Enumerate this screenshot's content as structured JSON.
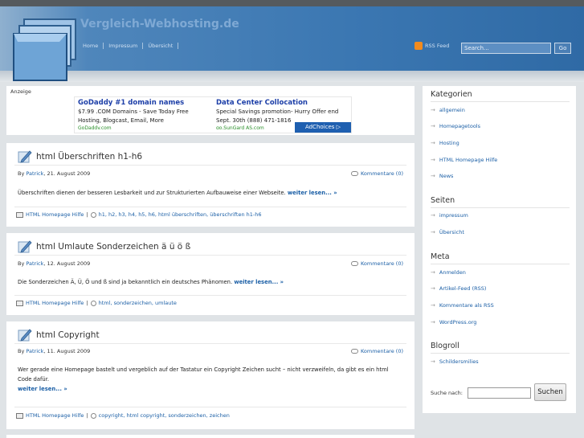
{
  "site": {
    "title": "Vergleich-Webhosting.de",
    "nav": [
      "Home",
      "Impressum",
      "Übersicht"
    ],
    "rss_label": "RSS Feed",
    "search_placeholder": "Search...",
    "go_label": "Go"
  },
  "ad": {
    "label": "Anzeige",
    "left": {
      "title": "GoDaddy #1 domain names",
      "line1": "$7.99 .COM Domains - Save Today Free",
      "line2": "Hosting, Blogcast, Email, More",
      "url": "GoDaddy.com"
    },
    "right": {
      "title": "Data Center Collocation",
      "line1": "Special Savings promotion- Hurry Offer end",
      "line2": "Sept. 30th (888) 471-1816",
      "url": "go.SunGard AS.com"
    },
    "adchoices": "AdChoices ▷"
  },
  "posts": [
    {
      "title": "html Überschriften h1-h6",
      "by": "By",
      "author": "Patrick",
      "date": ", 21. August 2009",
      "comments": "Kommentare (0)",
      "excerpt": "Überschriften dienen der besseren Lesbarkeit und zur Strukturierten Aufbauweise einer Webseite.",
      "more": "weiter lesen... »",
      "category": "HTML Homepage Hilfe",
      "tags": "h1, h2, h3, h4, h5, h6, html überschriften, überschriften h1-h6"
    },
    {
      "title": "html Umlaute Sonderzeichen ä ü ö ß",
      "by": "By",
      "author": "Patrick",
      "date": ", 12. August 2009",
      "comments": "Kommentare (0)",
      "excerpt": "Die Sonderzeichen Ä, Ü, Ö und ß sind ja bekanntlich ein deutsches Phänomen.",
      "more": "weiter lesen... »",
      "category": "HTML Homepage Hilfe",
      "tags": "html, sonderzeichen, umlaute"
    },
    {
      "title": "html Copyright",
      "by": "By",
      "author": "Patrick",
      "date": ", 11. August 2009",
      "comments": "Kommentare (0)",
      "excerpt": "Wer gerade eine Homepage bastelt und vergeblich auf der Tastatur ein Copyright Zeichen sucht – nicht verzweifeln, da gibt es ein html Code dafür.",
      "more": "weiter lesen... »",
      "category": "HTML Homepage Hilfe",
      "tags": "copyright, html copyright, sonderzeichen, zeichen"
    }
  ],
  "sidebar": {
    "kategorien": {
      "title": "Kategorien",
      "items": [
        "allgemein",
        "Homepagetools",
        "Hosting",
        "HTML Homepage Hilfe",
        "News"
      ]
    },
    "seiten": {
      "title": "Seiten",
      "items": [
        "impressum",
        "Übersicht"
      ]
    },
    "meta": {
      "title": "Meta",
      "items": [
        "Anmelden",
        "Artikel-Feed (RSS)",
        "Kommentare als RSS",
        "WordPress.org"
      ]
    },
    "blogroll": {
      "title": "Blogroll",
      "items": [
        "Schildersmilies"
      ]
    },
    "search_label": "Suche nach:",
    "search_button": "Suchen"
  }
}
